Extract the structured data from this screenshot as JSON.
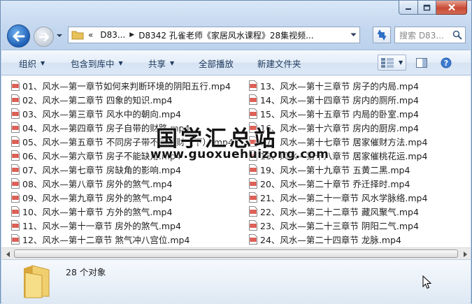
{
  "window": {
    "caption": {
      "minimize": "—",
      "maximize": "□",
      "close": "✕"
    }
  },
  "nav": {
    "back_icon": "arrow-left-icon",
    "forward_icon": "arrow-right-icon",
    "breadcrumb": [
      {
        "label": "«"
      },
      {
        "label": "D83..."
      },
      {
        "label": "D8342 孔雀老师《家居风水课程》28集视频..."
      }
    ],
    "search_placeholder": "搜索 D83...",
    "refresh_icon": "refresh-icon"
  },
  "toolbar": {
    "organize": "组织",
    "include_library": "包含到库中",
    "share": "共享",
    "play_all": "全部播放",
    "new_folder": "新建文件夹"
  },
  "files_left": [
    "01、风水—第一章节如何来判断环境的阴阳五行.mp4",
    "02、风水—第二章节 四象的知识.mp4",
    "03、风水—第三章节 风水中的朝向.mp4",
    "04、风水—第四章节 房子自带的财路.mp4",
    "05、风水—第五章节 不同房子带不同的财（下）.mp4",
    "06、风水—第六章节 房子不能缺角.mp4",
    "07、风水—第七章节 房缺角的影响.mp4",
    "08、风水—第八章节 房外的煞气.mp4",
    "09、风水—第九章节 房外的煞气.mp4",
    "10、风水—第十章节 方外的煞气.mp4",
    "11、风水—第十一章节 房外的煞气.mp4",
    "12、风水—第十二章节 煞气冲八宫位.mp4"
  ],
  "files_right": [
    "13、风水—第十三章节 房子的内局.mp4",
    "14、风水—第十四章节 房内的厕所.mp4",
    "15、风水—第十五章节 内局的卧室.mp4",
    "16、风水—第十六章节 房内的厨房.mp4",
    "17、风水—第十七章节 居家催财方法.mp4",
    "18、风水—第十八章节 居家催桃花运.mp4",
    "19、风水—第十九章节 五黄二黑.mp4",
    "20、风水—第二十章节 乔迁择时.mp4",
    "21、风水—第二十一章节 风水学脉络.mp4",
    "22、风水—第二十二章节 藏风聚气.mp4",
    "23、风水—第二十三章节 阴阳二气.mp4",
    "24、风水—第二十四章节 龙脉.mp4"
  ],
  "status": {
    "count": "28 个对象"
  },
  "watermark": {
    "title": "国学汇总站",
    "url": "www.guoxuehuizong.com"
  },
  "colors": {
    "accent": "#1f5fb6",
    "file_icon_red": "#d2372c",
    "toolbar_text": "#1e395b",
    "folder": "#e8c15a"
  }
}
